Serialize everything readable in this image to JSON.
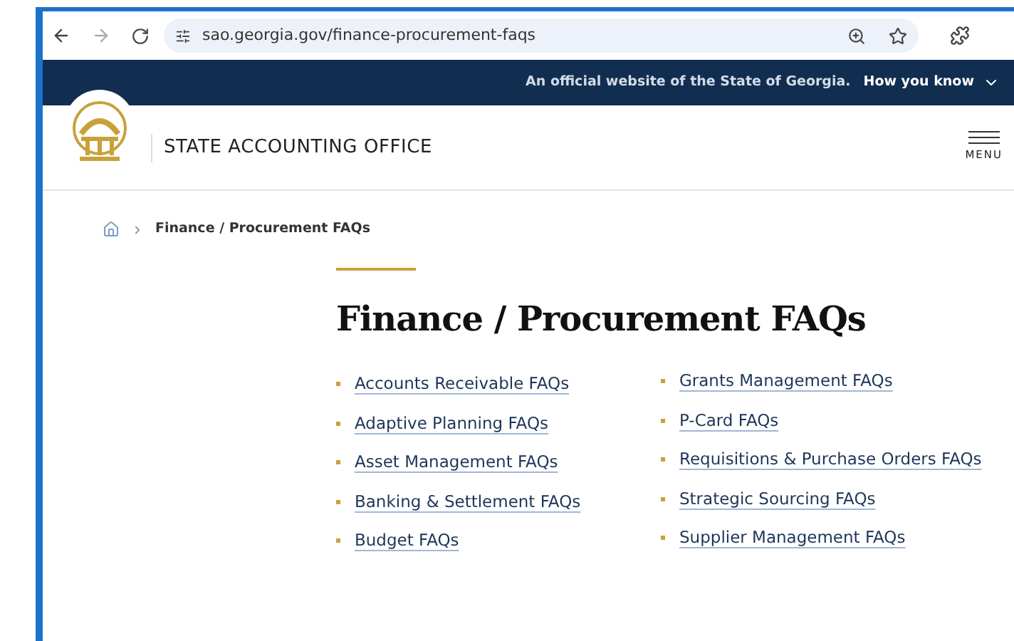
{
  "browser": {
    "url": "sao.georgia.gov/finance-procurement-faqs"
  },
  "banner": {
    "text": "An official website of the State of Georgia.",
    "link": "How you know"
  },
  "header": {
    "site_name": "STATE ACCOUNTING OFFICE",
    "menu_label": "MENU"
  },
  "breadcrumb": {
    "current": "Finance / Procurement FAQs"
  },
  "page_title": "Finance / Procurement FAQs",
  "links_left": [
    "Accounts Receivable FAQs",
    "Adaptive Planning FAQs",
    "Asset Management FAQs",
    "Banking & Settlement FAQs",
    "Budget FAQs"
  ],
  "links_right": [
    "Grants Management FAQs",
    "P-Card FAQs",
    "Requisitions & Purchase Orders FAQs",
    "Strategic Sourcing FAQs",
    "Supplier Management FAQs"
  ]
}
